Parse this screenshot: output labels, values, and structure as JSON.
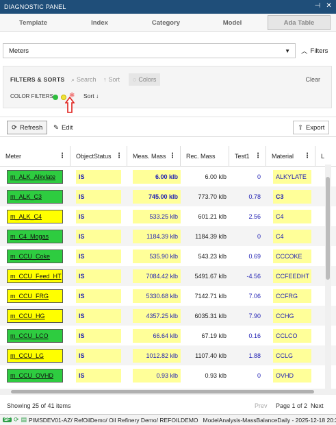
{
  "window": {
    "title": "DIAGNOSTIC PANEL"
  },
  "tabs": [
    "Template",
    "Index",
    "Category",
    "Model",
    "Ada Table"
  ],
  "active_tab": "Ada Table",
  "meters_select": {
    "value": "Meters"
  },
  "filters_toggle": "Filters",
  "filters_sorts": {
    "title": "FILTERS & SORTS",
    "search": "Search",
    "sort": "Sort",
    "colors": "Colors",
    "clear": "Clear",
    "color_filters_label": "COLOR FILTERS:",
    "sort_label": "Sort",
    "color_filter_colors": [
      "#2ebd3d",
      "#f0e23a",
      "#f08080"
    ]
  },
  "toolbar": {
    "refresh": "Refresh",
    "edit": "Edit",
    "export": "Export"
  },
  "columns": [
    "Meter",
    "ObjectStatus",
    "Meas. Mass",
    "Rec. Mass",
    "Test1",
    "Material",
    "L"
  ],
  "rows": [
    {
      "meter": "m_ALK_Alkylate",
      "meter_color": "green",
      "status": "IS",
      "meas": "6.00 klb",
      "meas_bold": true,
      "rec": "6.00 klb",
      "test1": "0",
      "material": "ALKYLATE",
      "mat_bold": false
    },
    {
      "meter": "m_ALK_C3",
      "meter_color": "green",
      "status": "IS",
      "meas": "745.00 klb",
      "meas_bold": true,
      "rec": "773.70 klb",
      "test1": "0.78",
      "material": "C3",
      "mat_bold": true
    },
    {
      "meter": "m_ALK_C4",
      "meter_color": "yellow",
      "status": "IS",
      "meas": "533.25 klb",
      "meas_bold": false,
      "rec": "601.21 klb",
      "test1": "2.56",
      "material": "C4",
      "mat_bold": false
    },
    {
      "meter": "m_C4_Mogas",
      "meter_color": "green",
      "status": "IS",
      "meas": "1184.39 klb",
      "meas_bold": false,
      "rec": "1184.39 klb",
      "test1": "0",
      "material": "C4",
      "mat_bold": false
    },
    {
      "meter": "m_CCU_Coke",
      "meter_color": "green",
      "status": "IS",
      "meas": "535.90 klb",
      "meas_bold": false,
      "rec": "543.23 klb",
      "test1": "0.69",
      "material": "CCCOKE",
      "mat_bold": false
    },
    {
      "meter": "m_CCU_Feed_HT",
      "meter_color": "yellow",
      "status": "IS",
      "meas": "7084.42 klb",
      "meas_bold": false,
      "rec": "5491.67 klb",
      "test1": "-4.56",
      "material": "CCFEEDHT",
      "mat_bold": false
    },
    {
      "meter": "m_CCU_FRG",
      "meter_color": "yellow",
      "status": "IS",
      "meas": "5330.68 klb",
      "meas_bold": false,
      "rec": "7142.71 klb",
      "test1": "7.06",
      "material": "CCFRG",
      "mat_bold": false
    },
    {
      "meter": "m_CCU_HG",
      "meter_color": "yellow",
      "status": "IS",
      "meas": "4357.25 klb",
      "meas_bold": false,
      "rec": "6035.31 klb",
      "test1": "7.90",
      "material": "CCHG",
      "mat_bold": false
    },
    {
      "meter": "m_CCU_LCO",
      "meter_color": "green",
      "status": "IS",
      "meas": "66.64 klb",
      "meas_bold": false,
      "rec": "67.19 klb",
      "test1": "0.16",
      "material": "CCLCO",
      "mat_bold": false
    },
    {
      "meter": "m_CCU_LG",
      "meter_color": "yellow",
      "status": "IS",
      "meas": "1012.82 klb",
      "meas_bold": false,
      "rec": "1107.40 klb",
      "test1": "1.88",
      "material": "CCLG",
      "mat_bold": false
    },
    {
      "meter": "m_CCU_OVHD",
      "meter_color": "green",
      "status": "IS",
      "meas": "0.93 klb",
      "meas_bold": false,
      "rec": "0.93 klb",
      "test1": "0",
      "material": "OVHD",
      "mat_bold": false
    }
  ],
  "footer": {
    "showing": "Showing 25 of 41 items",
    "prev": "Prev",
    "page": "Page 1 of 2",
    "next": "Next"
  },
  "statusbar": {
    "badge": "SF",
    "path": "PIMSDEV01-AZ/ RefOilDemo/ Oil Refinery Demo/ REFOILDEMO",
    "model": "ModelAnalysis-MassBalanceDaily - 2025-12-18 20:37 2"
  },
  "colors": {
    "title_bar": "#1f4e79",
    "meter_green": "#2ecc40",
    "meter_yellow": "#ffff00",
    "cell_yellow": "#ffff99",
    "value_blue": "#1f1fb3",
    "arrow_red": "#e0201c"
  }
}
